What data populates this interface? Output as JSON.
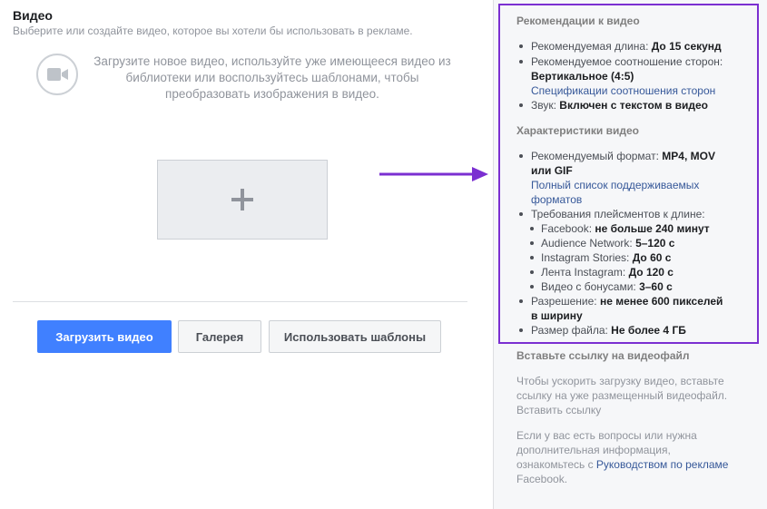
{
  "header": {
    "title": "Видео",
    "subtitle": "Выберите или создайте видео, которое вы хотели бы использовать в рекламе."
  },
  "upload": {
    "description": "Загрузите новое видео, используйте уже имеющееся видео из библиотеки или воспользуйтесь шаблонами, чтобы преобразовать изображения в видео."
  },
  "buttons": {
    "upload": "Загрузить видео",
    "gallery": "Галерея",
    "templates": "Использовать шаблоны"
  },
  "recommendations": {
    "title": "Рекомендации к видео",
    "length_label": "Рекомендуемая длина: ",
    "length_value": "До 15 секунд",
    "ratio_label": "Рекомендуемое соотношение сторон:",
    "ratio_value": "Вертикальное (4:5)",
    "ratio_link": "Спецификации соотношения сторон",
    "sound_label": "Звук: ",
    "sound_value": "Включен с текстом в видео"
  },
  "specs": {
    "title": "Характеристики видео",
    "format_label": "Рекомендуемый формат: ",
    "format_value_1": "MP4, MOV",
    "format_value_2": "или GIF",
    "format_link_1": "Полный список поддерживаемых",
    "format_link_2": "форматов",
    "placements_label": "Требования плейсментов к длине:",
    "placements": [
      {
        "name": "Facebook: ",
        "value": "не больше 240 минут"
      },
      {
        "name": "Audience Network: ",
        "value": "5–120 с"
      },
      {
        "name": "Instagram Stories: ",
        "value": "До 60 с"
      },
      {
        "name": "Лента Instagram: ",
        "value": "До 120 с"
      },
      {
        "name": "Видео с бонусами: ",
        "value": "3–60 с"
      }
    ],
    "resolution_label": "Разрешение: ",
    "resolution_value_1": "не менее 600 пикселей",
    "resolution_value_2": "в ширину",
    "size_label": "Размер файла: ",
    "size_value": "Не более 4 ГБ"
  },
  "link_section": {
    "title": "Вставьте ссылку на видеофайл",
    "text_1": "Чтобы ускорить загрузку видео, вставьте",
    "text_2": "ссылку на уже размещенный видеофайл.",
    "link": "Вставить ссылку"
  },
  "help": {
    "text_1": "Если у вас есть вопросы или нужна",
    "text_2": "дополнительная информация,",
    "text_3": "ознакомьтесь с ",
    "link": "Руководством по рекламе",
    "text_4": "Facebook."
  },
  "colors": {
    "accent": "#4080ff",
    "highlight_box": "#7b2fd1",
    "link": "#365899"
  }
}
